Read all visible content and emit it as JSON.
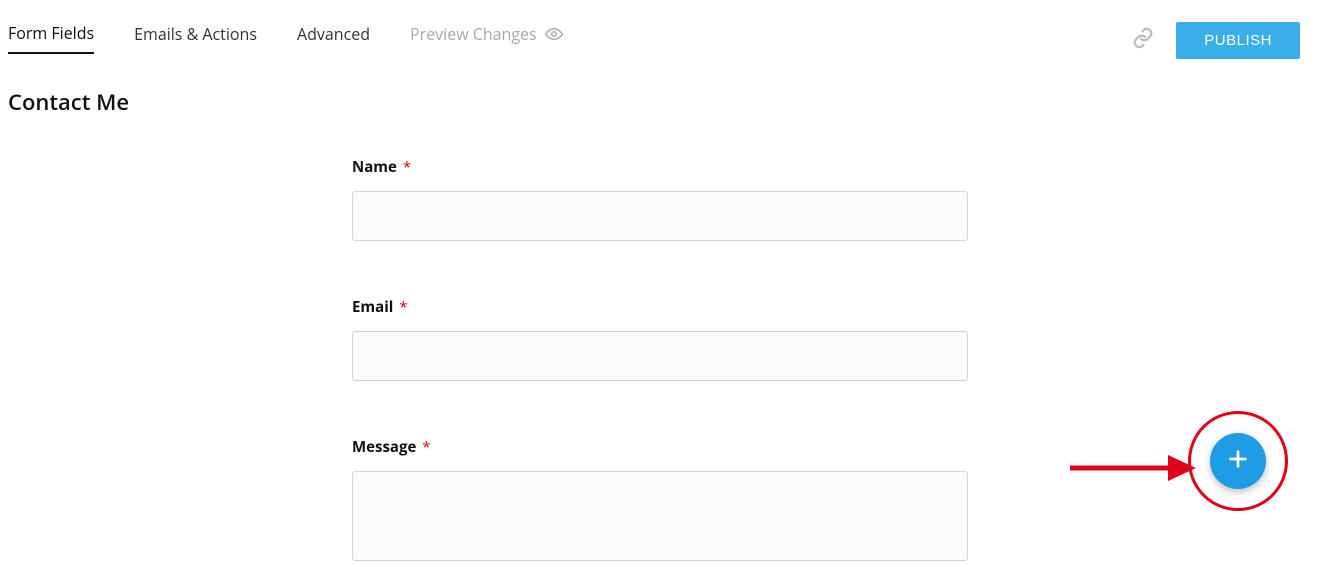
{
  "tabs": {
    "form_fields": "Form Fields",
    "emails_actions": "Emails & Actions",
    "advanced": "Advanced",
    "preview_changes": "Preview Changes"
  },
  "actions": {
    "publish": "PUBLISH"
  },
  "page": {
    "title": "Contact Me"
  },
  "fields": {
    "name": {
      "label": "Name",
      "required": "*"
    },
    "email": {
      "label": "Email",
      "required": "*"
    },
    "message": {
      "label": "Message",
      "required": "*"
    }
  }
}
